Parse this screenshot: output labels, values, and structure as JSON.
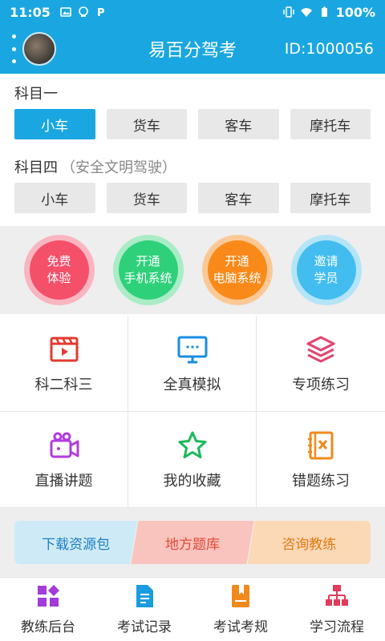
{
  "status_bar": {
    "time": "11:05",
    "battery": "100%"
  },
  "app_bar": {
    "title": "易百分驾考",
    "user_id": "ID:1000056"
  },
  "subject_one": {
    "title": "科目一",
    "vehicles": [
      "小车",
      "货车",
      "客车",
      "摩托车"
    ],
    "selected": "小车"
  },
  "subject_four": {
    "title": "科目四",
    "subtitle": "（安全文明驾驶）",
    "vehicles": [
      "小车",
      "货车",
      "客车",
      "摩托车"
    ]
  },
  "actions": [
    {
      "line1": "免费",
      "line2": "体验",
      "color": "#f4506a",
      "ring": "#f9b5c0"
    },
    {
      "line1": "开通",
      "line2": "手机系统",
      "color": "#2fd07a",
      "ring": "#a9ecc6"
    },
    {
      "line1": "开通",
      "line2": "电脑系统",
      "color": "#f98a1a",
      "ring": "#fcc996"
    },
    {
      "line1": "邀请",
      "line2": "学员",
      "color": "#43bdf0",
      "ring": "#b4e4f8"
    }
  ],
  "grid": [
    {
      "label": "科二科三",
      "icon": "video-clapper-icon",
      "color": "#e33b2f"
    },
    {
      "label": "全真模拟",
      "icon": "monitor-icon",
      "color": "#1a8de0"
    },
    {
      "label": "专项练习",
      "icon": "layers-icon",
      "color": "#e2456e"
    },
    {
      "label": "直播讲题",
      "icon": "camcorder-icon",
      "color": "#b23be0"
    },
    {
      "label": "我的收藏",
      "icon": "star-icon",
      "color": "#1cb85a"
    },
    {
      "label": "错题练习",
      "icon": "notebook-x-icon",
      "color": "#f08a1c"
    }
  ],
  "tags": [
    "下载资源包",
    "地方题库",
    "咨询教练"
  ],
  "tabs": [
    {
      "label": "教练后台",
      "icon": "dashboard-icon",
      "color": "#a23bd8"
    },
    {
      "label": "考试记录",
      "icon": "document-icon",
      "color": "#1a9de0"
    },
    {
      "label": "考试考规",
      "icon": "rulebook-icon",
      "color": "#f08a1c"
    },
    {
      "label": "学习流程",
      "icon": "flowchart-icon",
      "color": "#e23b5a"
    }
  ]
}
